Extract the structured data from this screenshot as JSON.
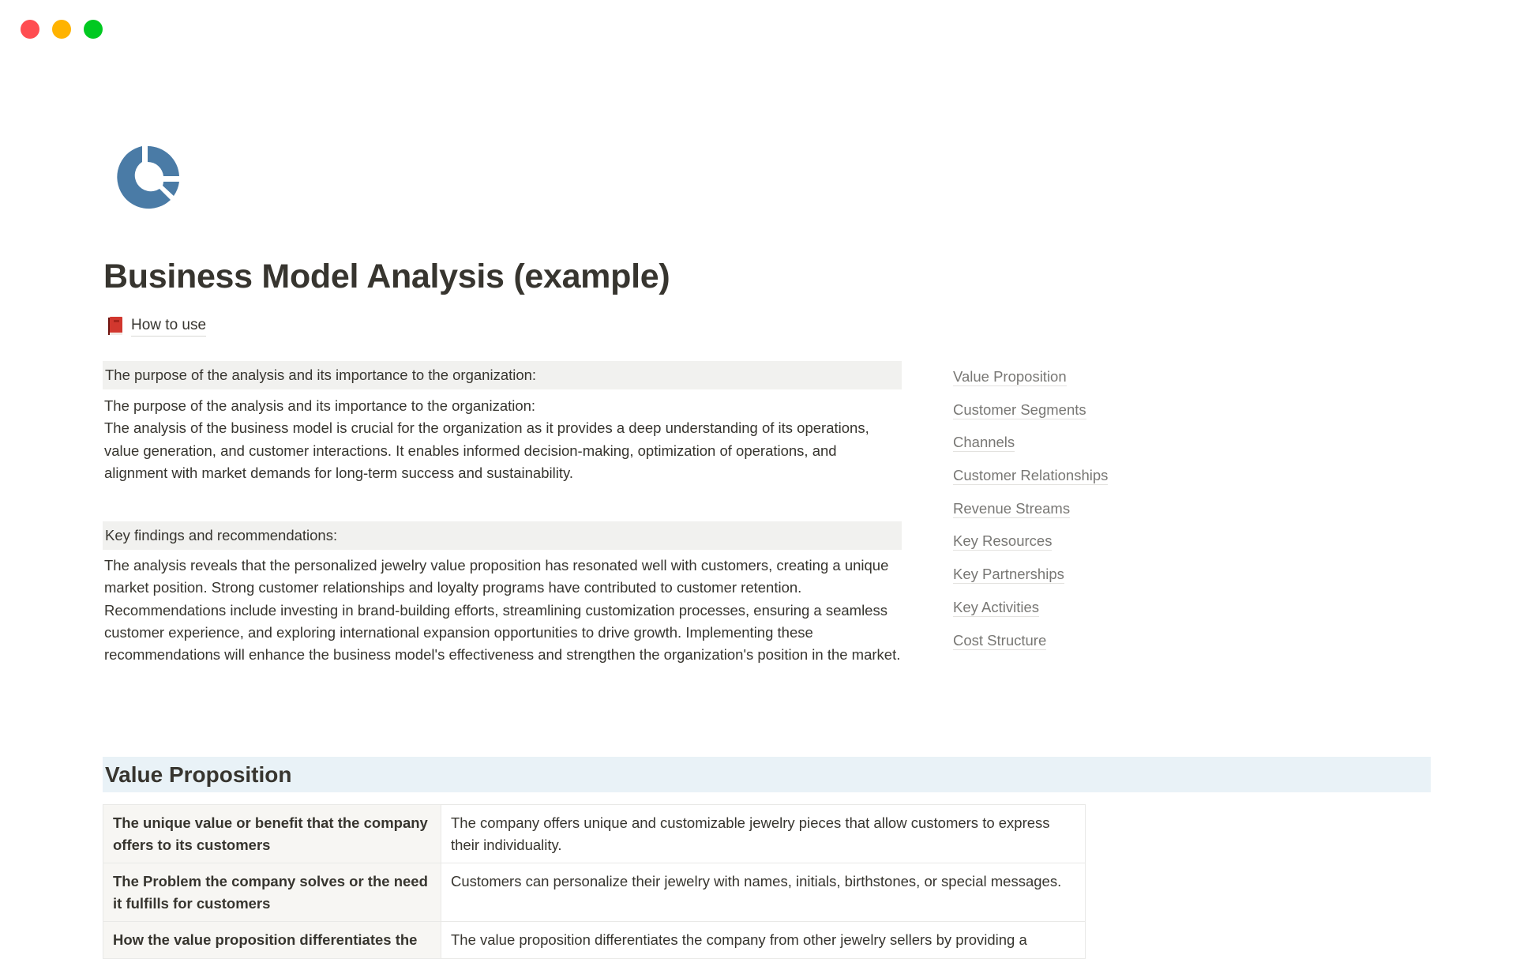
{
  "window": {
    "controls": [
      "close",
      "minimize",
      "maximize"
    ],
    "colors": {
      "close": "#ff4d51",
      "minimize": "#ffb300",
      "maximize": "#00c921"
    }
  },
  "page": {
    "icon": "donut-chart-icon",
    "icon_color": "#4a7ba6",
    "title": "Business Model Analysis (example)",
    "how_to_use": {
      "icon": "red-book-icon",
      "label": "How to use"
    }
  },
  "purpose": {
    "callout": "The purpose of the analysis and its importance to the organization:",
    "lines": [
      "The purpose of the analysis and its importance to the organization:",
      "The analysis of the business model is crucial for the organization as it provides a deep understanding of its operations, value generation, and customer interactions. It enables informed decision-making, optimization of operations, and alignment with market demands for long-term success and sustainability."
    ]
  },
  "findings": {
    "callout": "Key findings and recommendations:",
    "text": "The analysis reveals that the personalized jewelry value proposition has resonated well with customers, creating a unique market position. Strong customer relationships and loyalty programs have contributed to customer retention. Recommendations include investing in brand-building efforts, streamlining customization processes, ensuring a seamless customer experience, and exploring international expansion opportunities to drive growth. Implementing these recommendations will enhance the business model's effectiveness and strengthen the organization's position in the market."
  },
  "toc": [
    "Value Proposition",
    "Customer Segments",
    "Channels",
    "Customer Relationships",
    "Revenue Streams",
    "Key Resources",
    "Key Partnerships",
    "Key Activities",
    "Cost Structure"
  ],
  "value_proposition": {
    "heading": "Value Proposition",
    "heading_bg": "#e9f2f7",
    "rows": [
      {
        "key": "The unique value or benefit that the company offers to its customers",
        "value": "The company offers unique and customizable jewelry pieces that allow customers to express their individuality."
      },
      {
        "key": "The Problem the company solves or the need it fulfills for customers",
        "value": "Customers can personalize their jewelry with names, initials, birthstones, or special messages."
      },
      {
        "key": "How the value proposition differentiates the",
        "value": "The value proposition differentiates the company from other jewelry sellers by providing a"
      }
    ]
  }
}
